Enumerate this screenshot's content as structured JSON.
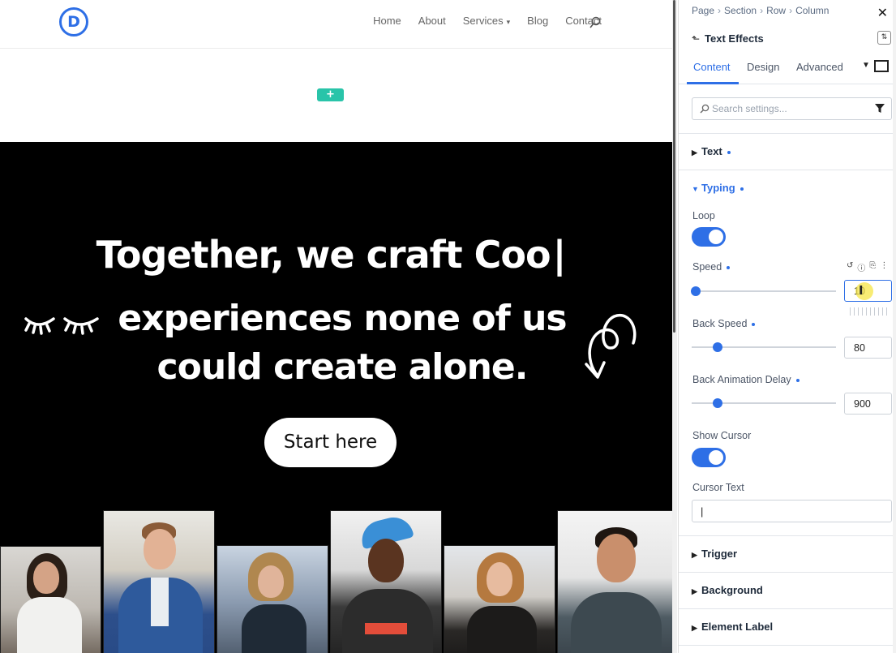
{
  "site": {
    "logo_letter": "D",
    "nav": [
      {
        "label": "Home"
      },
      {
        "label": "About"
      },
      {
        "label": "Services",
        "chevron": "▾"
      },
      {
        "label": "Blog"
      },
      {
        "label": "Contact"
      }
    ],
    "add_section_label": "+",
    "hero": {
      "line1": "Together, we craft Coo",
      "caret": "|",
      "line2": "experiences none of us",
      "line3": "could create alone.",
      "button_label": "Start here"
    }
  },
  "panel": {
    "breadcrumb": [
      "Page",
      "Section",
      "Row",
      "Column"
    ],
    "breadcrumb_sep": "›",
    "close_icon": "✕",
    "back_icon": "⬑",
    "title": "Text Effects",
    "layout_icon": "⇅",
    "tabs": {
      "content": "Content",
      "design": "Design",
      "advanced": "Advanced"
    },
    "tab_more_icon": "▼",
    "search": {
      "placeholder": "Search settings..."
    },
    "groups": {
      "text": "Text",
      "typing": "Typing",
      "trigger": "Trigger",
      "background": "Background",
      "element_label": "Element Label"
    },
    "collapsed_icon": "▶",
    "expanded_icon": "▼",
    "fields": {
      "loop": {
        "label": "Loop",
        "value": true
      },
      "speed": {
        "label": "Speed",
        "value": "10",
        "slider_fraction": 0.03,
        "tools": [
          "↺",
          "ⓘ",
          "⎘",
          "⋮"
        ]
      },
      "back_speed": {
        "label": "Back Speed",
        "value": "80",
        "slider_fraction": 0.18
      },
      "back_animation_delay": {
        "label": "Back Animation Delay",
        "value": "900",
        "slider_fraction": 0.18
      },
      "show_cursor": {
        "label": "Show Cursor",
        "value": true
      },
      "cursor_text": {
        "label": "Cursor Text",
        "value": "|"
      }
    },
    "text_cursor_glyph": "I",
    "accent_color": "#2e6fe6"
  }
}
